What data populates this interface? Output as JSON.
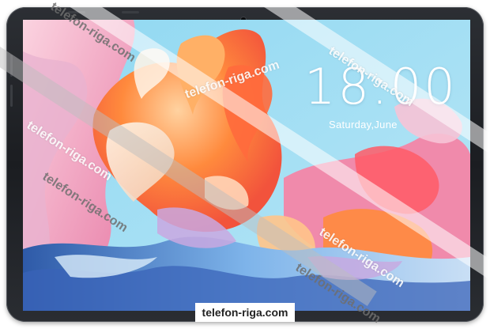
{
  "lock_screen": {
    "time": "18:00",
    "date": "Saturday,June"
  },
  "wallpaper": {
    "colors": {
      "sky": "#7ed0ee",
      "orange": "#ff8a3d",
      "coral": "#ff5a4e",
      "pink": "#f5a5c0",
      "cream": "#f7e7d6",
      "blue": "#5f8fd6",
      "lilac": "#c9a8e0"
    }
  },
  "watermark": {
    "text": "telefon-riga.com",
    "bottom_label": "telefon-riga.com"
  }
}
